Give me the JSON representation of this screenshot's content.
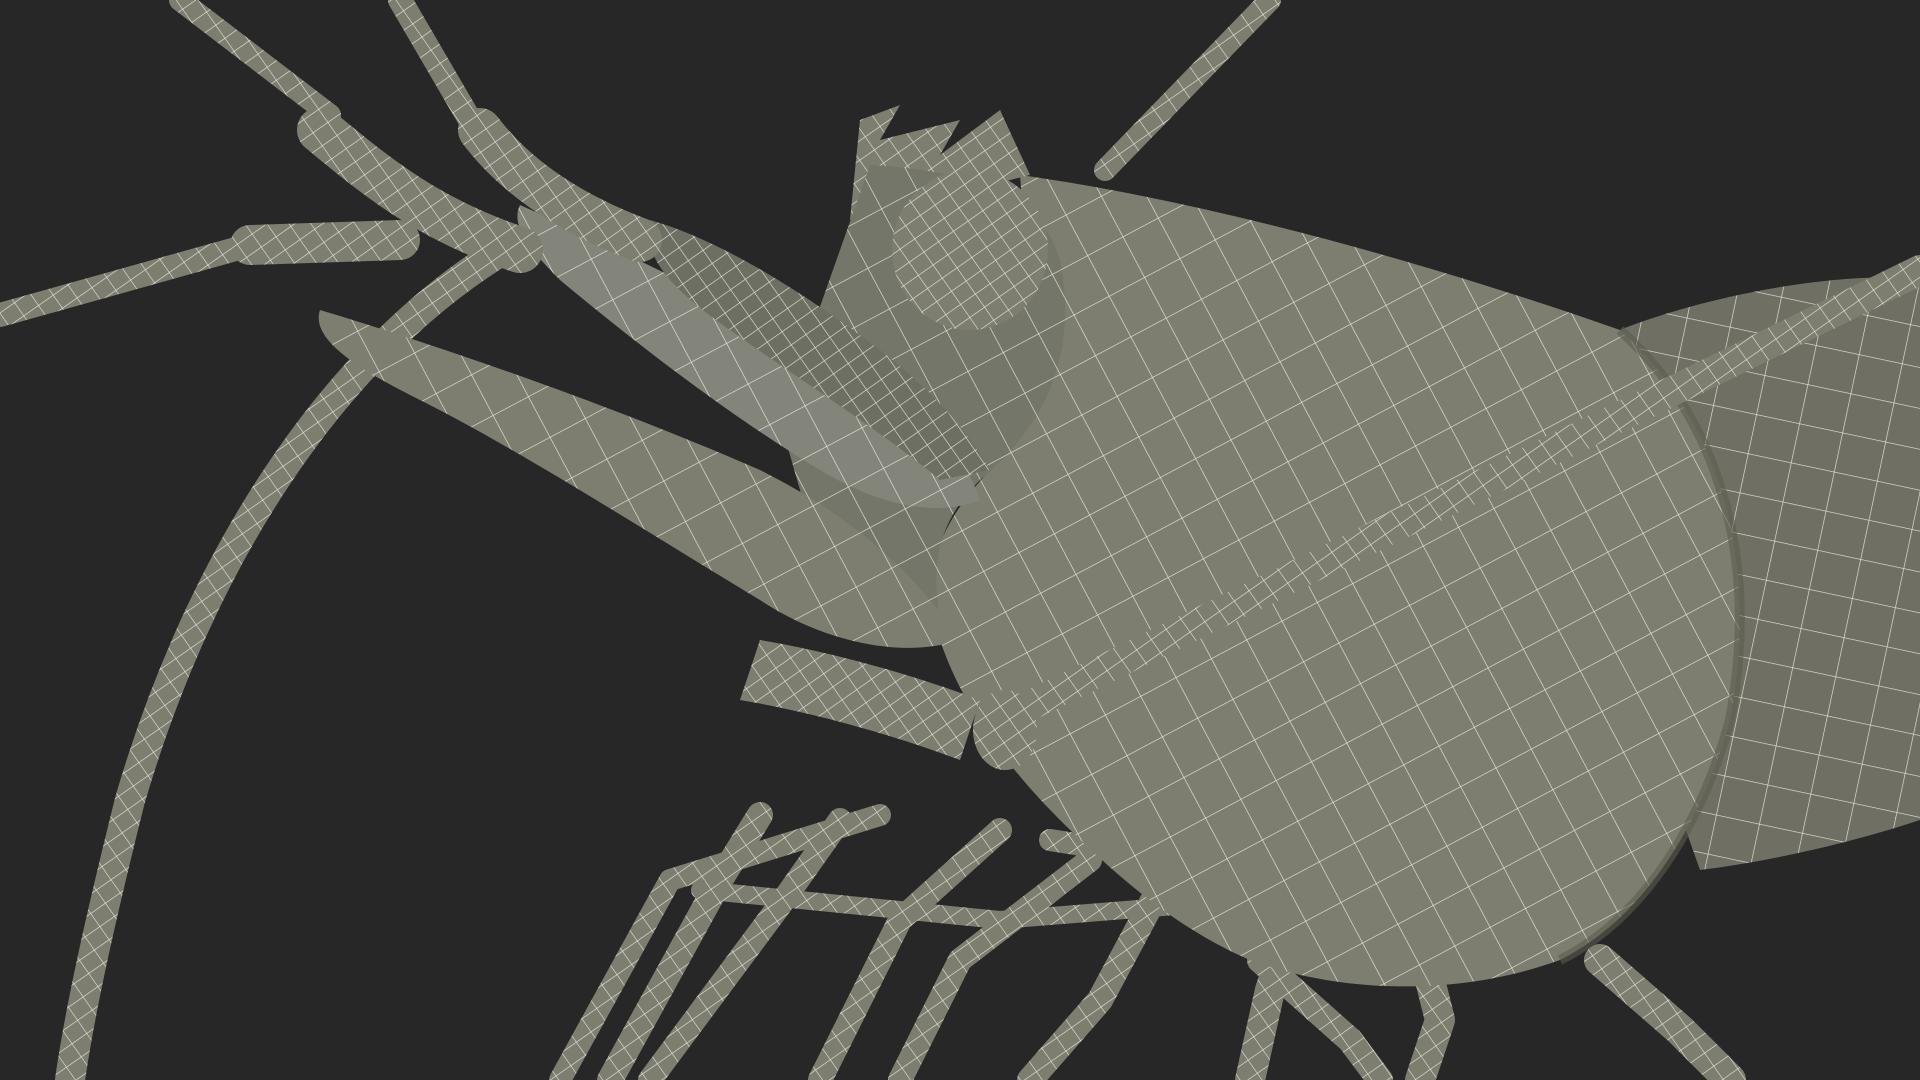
{
  "render": {
    "subject": "shrimp-wireframe-model",
    "view": "close-up-head-side",
    "colors": {
      "background": "#272727",
      "body_fill": "#7d7e6f",
      "body_shade": "#6a6b5e",
      "body_light": "#8b8c7c",
      "wire": "#f2f2ec"
    }
  }
}
